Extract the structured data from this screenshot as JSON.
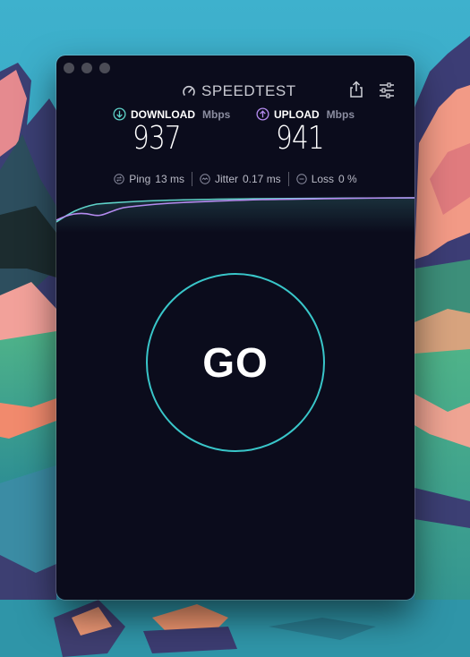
{
  "app": {
    "brand": "SPEEDTEST",
    "share_icon": "share-icon",
    "settings_icon": "sliders-icon"
  },
  "download": {
    "label": "DOWNLOAD",
    "unit": "Mbps",
    "value": "937",
    "icon": "arrow-down-circle-icon",
    "color": "#5fd3c9"
  },
  "upload": {
    "label": "UPLOAD",
    "unit": "Mbps",
    "value": "941",
    "icon": "arrow-up-circle-icon",
    "color": "#b58bf0"
  },
  "stats": {
    "ping": {
      "label": "Ping",
      "value": "13 ms",
      "icon": "ping-icon"
    },
    "jitter": {
      "label": "Jitter",
      "value": "0.17 ms",
      "icon": "jitter-icon"
    },
    "loss": {
      "label": "Loss",
      "value": "0 %",
      "icon": "loss-icon"
    }
  },
  "go": {
    "label": "GO",
    "accent": "#39c6c9"
  },
  "colors": {
    "window_bg": "#0b0c1c",
    "wallpaper": "#3ba6c4"
  }
}
